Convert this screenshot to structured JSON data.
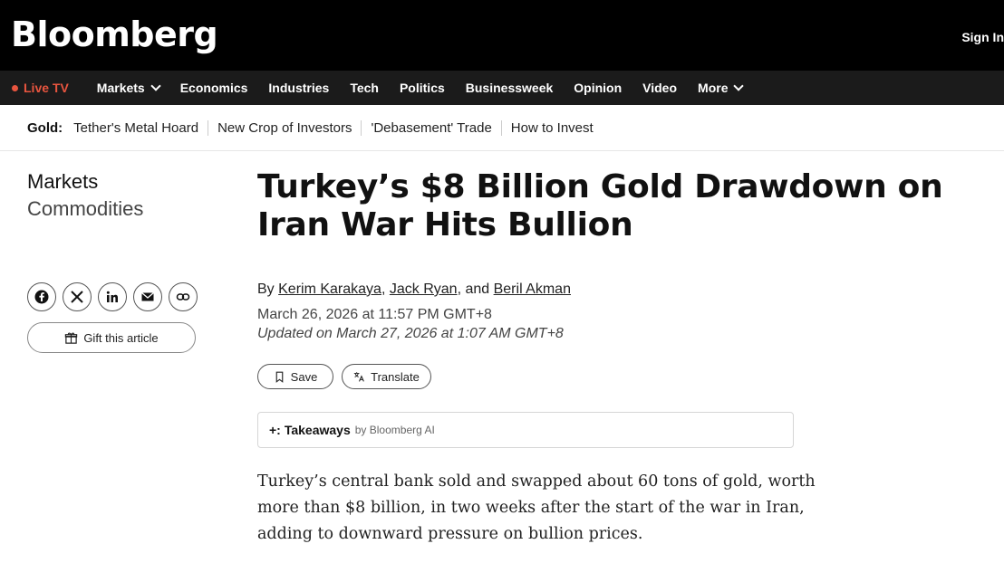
{
  "header": {
    "logo": "Bloomberg",
    "signin": "Sign In"
  },
  "nav": {
    "live": "Live TV",
    "items": [
      "Markets",
      "Economics",
      "Industries",
      "Tech",
      "Politics",
      "Businessweek",
      "Opinion",
      "Video",
      "More"
    ]
  },
  "subnav": {
    "label": "Gold:",
    "links": [
      "Tether's Metal Hoard",
      "New Crop of Investors",
      "'Debasement' Trade",
      "How to Invest"
    ]
  },
  "section": {
    "primary": "Markets",
    "secondary": "Commodities"
  },
  "article": {
    "headline": "Turkey’s $8 Billion Gold Drawdown on Iran War Hits Bullion",
    "by": "By",
    "authors": [
      "Kerim Karakaya",
      "Jack Ryan",
      "Beril Akman"
    ],
    "author_sep1": ",",
    "author_sep2": ", and",
    "published": "March 26, 2026 at 11:57 PM GMT+8",
    "updated": "Updated on March 27, 2026 at 1:07 AM GMT+8",
    "lede": "Turkey’s central bank sold and swapped about 60 tons of gold, worth more than $8 billion, in two weeks after the start of the war in Iran, adding to downward pressure on bullion prices."
  },
  "actions": {
    "gift": "Gift this article",
    "save": "Save",
    "translate": "Translate"
  },
  "takeaways": {
    "spark": "+:",
    "label": "Takeaways",
    "by": "by Bloomberg AI"
  },
  "share_icons": [
    "facebook-icon",
    "x-icon",
    "linkedin-icon",
    "email-icon",
    "link-icon"
  ],
  "colors": {
    "live": "#e8553f",
    "topbar": "#000000",
    "nav": "#1b1b1b"
  }
}
